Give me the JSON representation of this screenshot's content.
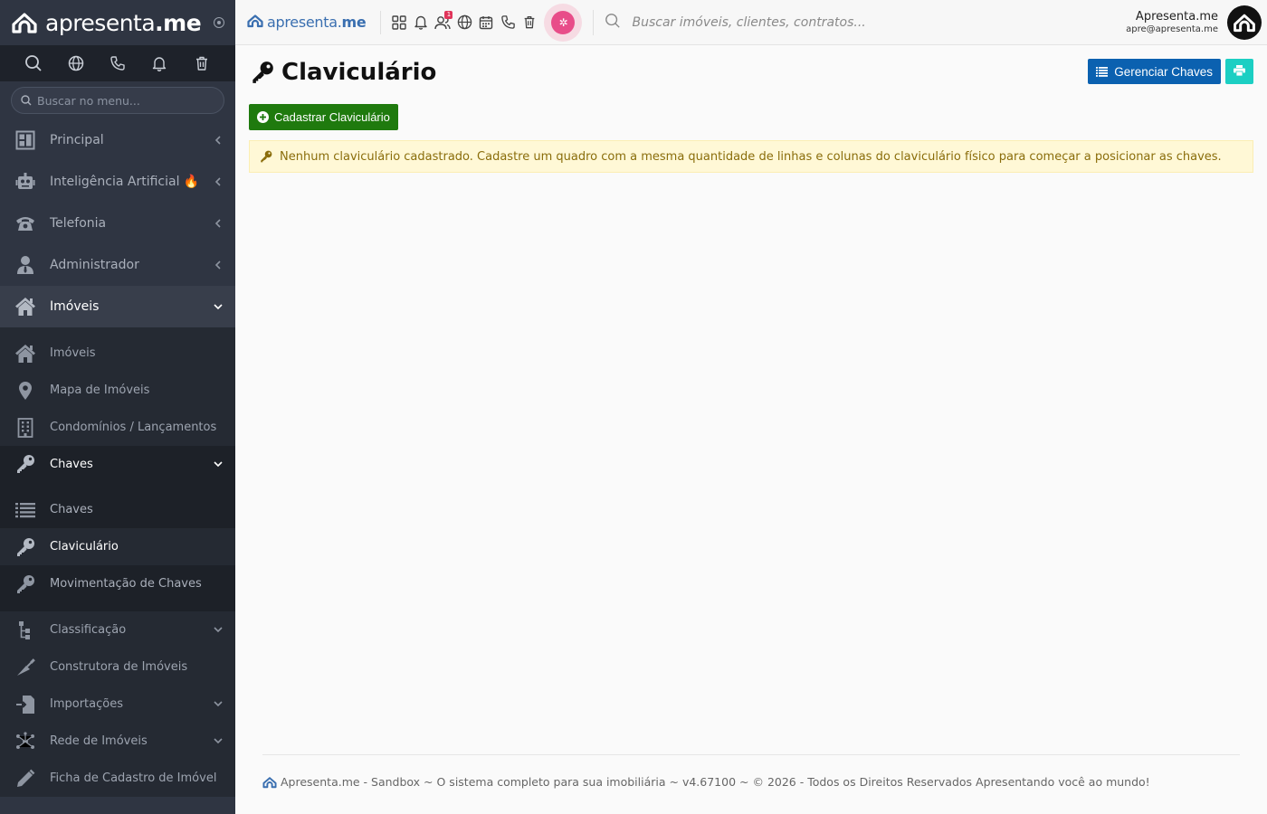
{
  "brand": {
    "name_light": "apresenta",
    "name_bold": ".me"
  },
  "sidebar": {
    "search_placeholder": "Buscar no menu...",
    "quick_icons": [
      "search-icon",
      "globe-icon",
      "phone-icon",
      "bell-icon",
      "trash-icon"
    ],
    "items": [
      {
        "label": "Principal",
        "icon": "dashboard-icon"
      },
      {
        "label": "Inteligência Artificial 🔥",
        "icon": "robot-icon"
      },
      {
        "label": "Telefonia",
        "icon": "telephone-icon"
      },
      {
        "label": "Administrador",
        "icon": "user-tie-icon"
      },
      {
        "label": "Imóveis",
        "icon": "home-icon"
      }
    ],
    "imoveis_sub": [
      {
        "label": "Imóveis",
        "icon": "home-icon"
      },
      {
        "label": "Mapa de Imóveis",
        "icon": "map-marker-icon"
      },
      {
        "label": "Condomínios / Lançamentos",
        "icon": "building-icon"
      },
      {
        "label": "Chaves",
        "icon": "key-icon"
      }
    ],
    "chaves_sub": [
      {
        "label": "Chaves",
        "icon": "list-icon"
      },
      {
        "label": "Claviculário",
        "icon": "key-icon"
      },
      {
        "label": "Movimentação de Chaves",
        "icon": "key-icon"
      }
    ],
    "imoveis_sub2": [
      {
        "label": "Classificação",
        "icon": "sitemap-icon"
      },
      {
        "label": "Construtora de Imóveis",
        "icon": "trowel-icon"
      },
      {
        "label": "Importações",
        "icon": "import-icon"
      },
      {
        "label": "Rede de Imóveis",
        "icon": "network-icon"
      },
      {
        "label": "Ficha de Cadastro de Imóvel",
        "icon": "pencil-icon"
      }
    ]
  },
  "topbar": {
    "logo_light": "apresenta",
    "logo_bold": "me",
    "notification_badge": "1",
    "search_placeholder": "Buscar imóveis, clientes, contratos...",
    "user_name": "Apresenta.me",
    "user_email": "apre@apresenta.me"
  },
  "page": {
    "title": "Claviculário",
    "manage_button": "Gerenciar Chaves",
    "add_button": "Cadastrar Claviculário",
    "alert_text": "Nenhum claviculário cadastrado. Cadastre um quadro com a mesma quantidade de linhas e colunas do claviculário físico para começar a posicionar as chaves."
  },
  "footer": {
    "text": "Apresenta.me - Sandbox ~ O sistema completo para sua imobiliária ~ v4.67100 ~ © 2026 - Todos os Direitos Reservados Apresentando você ao mundo!"
  },
  "colors": {
    "sidebar_bg": "#2f3542",
    "primary_button": "#0b61b0",
    "success_button": "#1f7a0e",
    "print_button": "#1ccfc3",
    "alert_bg": "#fff8d6",
    "alert_text": "#8a6d0b",
    "ai_accent": "#e84d89"
  }
}
